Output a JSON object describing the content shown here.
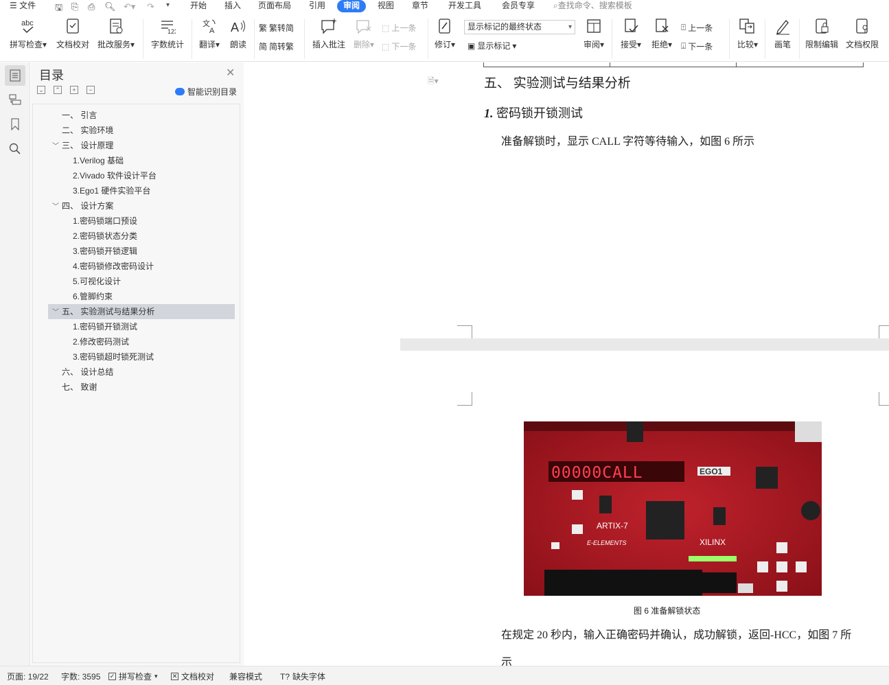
{
  "menu": {
    "file": "文件",
    "tabs": [
      "开始",
      "插入",
      "页面布局",
      "引用",
      "审阅",
      "视图",
      "章节",
      "开发工具",
      "会员专享"
    ],
    "active_tab": "审阅",
    "search": "查找命令、搜索模板"
  },
  "ribbon": {
    "spell": "拼写检查",
    "proof": "文档校对",
    "batch": "批改服务",
    "wordcount": "字数统计",
    "translate": "翻译",
    "read": "朗读",
    "trad": "繁转简",
    "simp": "简转繁",
    "insert_comment": "插入批注",
    "delete": "删除",
    "prev_c": "上一条",
    "next_c": "下一条",
    "revise": "修订",
    "markup_select": "显示标记的最终状态",
    "show_markup": "显示标记",
    "review": "审阅",
    "accept": "接受",
    "reject": "拒绝",
    "prev": "上一条",
    "next": "下一条",
    "compare": "比较",
    "pen": "画笔",
    "restrict": "限制编辑",
    "perm": "文档权限"
  },
  "toc": {
    "title": "目录",
    "smart": "智能识别目录",
    "items": [
      "一、 引言",
      "二、 实验环境",
      "三、 设计原理",
      "1.Verilog 基础",
      "2.Vivado 软件设计平台",
      "3.Ego1 硬件实验平台",
      "四、 设计方案",
      "1.密码锁端口预设",
      "2.密码锁状态分类",
      "3.密码锁开锁逻辑",
      "4.密码锁修改密码设计",
      "5.可视化设计",
      "6.管脚约束",
      "五、 实验测试与结果分析",
      "1.密码锁开锁测试",
      "2.修改密码测试",
      "3.密码锁超时锁死测试",
      "六、 设计总结",
      "七、 致谢"
    ]
  },
  "doc": {
    "heading": "五、 实验测试与结果分析",
    "subheading_num": "1.",
    "subheading": "密码锁开锁测试",
    "para1": "准备解锁时，显示 CALL 字符等待输入，如图 6 所示",
    "board_display": "00000CALL",
    "board_brand": "EGO1",
    "board_chip": "ARTIX-7",
    "board_vendor": "XILINX",
    "board_maker": "E-ELEMENTS",
    "caption": "图 6 准备解锁状态",
    "para2": "在规定 20 秒内，输入正确密码并确认，成功解锁，返回-HCC，如图 7 所",
    "para2b": "示"
  },
  "status": {
    "page": "页面: 19/22",
    "words": "字数: 3595",
    "spell": "拼写检查",
    "proof": "文档校对",
    "compat": "兼容模式",
    "font": "缺失字体"
  }
}
